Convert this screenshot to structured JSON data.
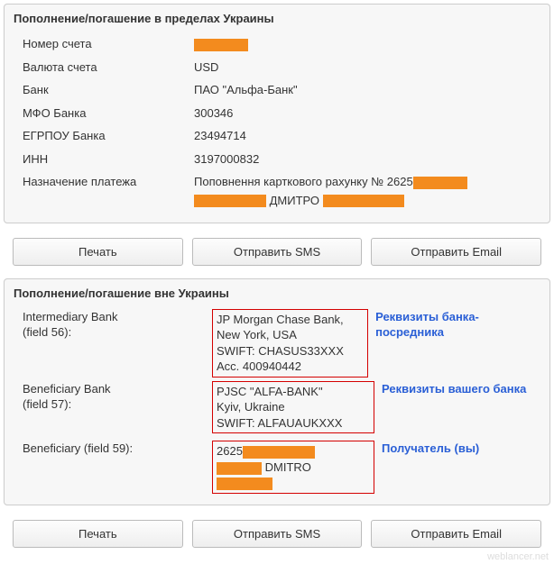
{
  "panel1": {
    "title": "Пополнение/погашение в пределах Украины",
    "rows": {
      "account_no_label": "Номер счета",
      "currency_label": "Валюта счета",
      "currency_value": "USD",
      "bank_label": "Банк",
      "bank_value": "ПАО \"Альфа-Банк\"",
      "mfo_label": "МФО Банка",
      "mfo_value": "300346",
      "egrpou_label": "ЕГРПОУ Банка",
      "egrpou_value": "23494714",
      "inn_label": "ИНН",
      "inn_value": "3197000832",
      "purpose_label": "Назначение платежа",
      "purpose_line1_prefix": "Поповнення карткового рахунку № 2625",
      "purpose_line2_mid": "ДМИТРО"
    }
  },
  "buttons": {
    "print": "Печать",
    "sms": "Отправить SMS",
    "email": "Отправить Email"
  },
  "panel2": {
    "title": "Пополнение/погашение вне Украины",
    "intermediary": {
      "label": "Intermediary Bank",
      "sublabel": "(field 56):",
      "line1": "JP Morgan Chase Bank, New York, USA",
      "line2": "SWIFT: CHASUS33XXX",
      "line3": "Acc. 400940442",
      "annot": "Реквизиты банка-посредника"
    },
    "beneficiary_bank": {
      "label": "Beneficiary Bank",
      "sublabel": "(field 57):",
      "line1": "PJSC \"ALFA-BANK\"",
      "line2": "Kyiv, Ukraine",
      "line3": "SWIFT: ALFAUAUKXXX",
      "annot": "Реквизиты вашего банка"
    },
    "beneficiary": {
      "label": "Beneficiary (field 59):",
      "line1_prefix": "2625",
      "line2_mid": "DMITRO",
      "annot": "Получатель (вы)"
    }
  },
  "watermark": "weblancer.net"
}
